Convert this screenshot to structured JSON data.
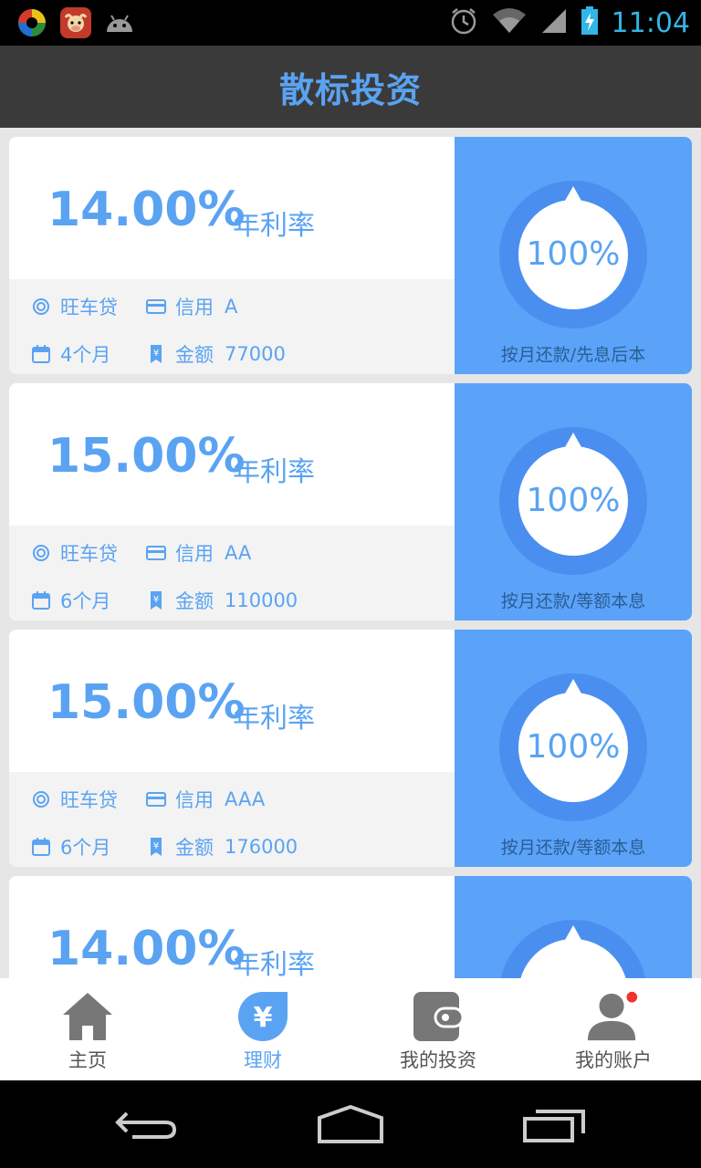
{
  "status_bar": {
    "time": "11:04",
    "icons": [
      "app-360-icon",
      "app-cow-icon",
      "android-icon",
      "alarm-icon",
      "wifi-icon",
      "signal-icon",
      "battery-charging-icon"
    ]
  },
  "header": {
    "title": "散标投资"
  },
  "cards": [
    {
      "rate": "14.00%",
      "rate_label": "年利率",
      "product": "旺车贷",
      "credit_label": "信用",
      "credit": "A",
      "term": "4个月",
      "amount_label": "金额",
      "amount": "77000",
      "progress": "100%",
      "repay": "按月还款/先息后本"
    },
    {
      "rate": "15.00%",
      "rate_label": "年利率",
      "product": "旺车贷",
      "credit_label": "信用",
      "credit": "AA",
      "term": "6个月",
      "amount_label": "金额",
      "amount": "110000",
      "progress": "100%",
      "repay": "按月还款/等额本息"
    },
    {
      "rate": "15.00%",
      "rate_label": "年利率",
      "product": "旺车贷",
      "credit_label": "信用",
      "credit": "AAA",
      "term": "6个月",
      "amount_label": "金额",
      "amount": "176000",
      "progress": "100%",
      "repay": "按月还款/等额本息"
    },
    {
      "rate": "14.00%",
      "rate_label": "年利率"
    }
  ],
  "tabs": [
    {
      "label": "主页",
      "icon": "home-icon"
    },
    {
      "label": "理财",
      "icon": "yen-icon",
      "active": true
    },
    {
      "label": "我的投资",
      "icon": "wallet-icon"
    },
    {
      "label": "我的账户",
      "icon": "user-icon",
      "badge": true
    }
  ],
  "nav": {
    "back": "back-icon",
    "home": "home-nav-icon",
    "recents": "recents-icon"
  },
  "colors": {
    "accent": "#5aa3f2",
    "card_right": "#5aa3f8",
    "ring": "#4a8ff0",
    "badge": "#f0332f"
  }
}
